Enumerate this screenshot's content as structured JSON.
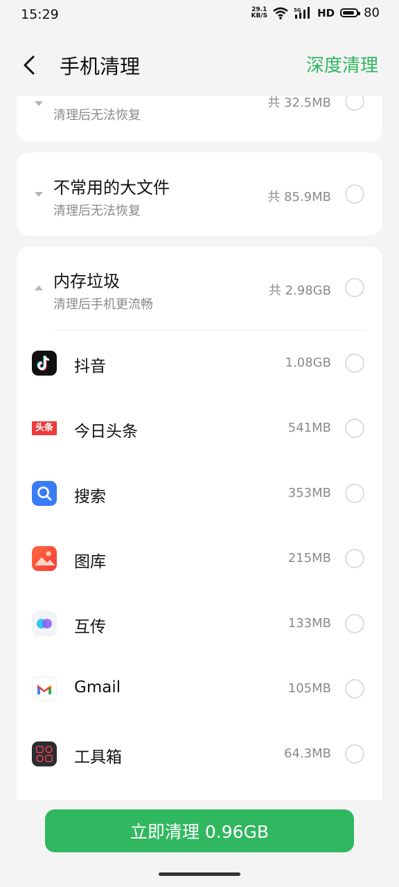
{
  "status_bar": {
    "time": "15:29",
    "net_speed_value": "29.1",
    "net_speed_unit": "KB/S",
    "network": "5G",
    "hd": "HD",
    "battery": "80"
  },
  "header": {
    "title": "手机清理",
    "action": "深度清理"
  },
  "sections": [
    {
      "title": "",
      "subtitle": "清理后无法恢复",
      "total": "共 32.5MB",
      "expanded": false
    },
    {
      "title": "不常用的大文件",
      "subtitle": "清理后无法恢复",
      "total": "共 85.9MB",
      "expanded": false
    },
    {
      "title": "内存垃圾",
      "subtitle": "清理后手机更流畅",
      "total": "共 2.98GB",
      "expanded": true
    }
  ],
  "apps": [
    {
      "name": "抖音",
      "size": "1.08GB",
      "icon": "douyin-icon"
    },
    {
      "name": "今日头条",
      "size": "541MB",
      "icon": "toutiao-icon"
    },
    {
      "name": "搜索",
      "size": "353MB",
      "icon": "search-app-icon"
    },
    {
      "name": "图库",
      "size": "215MB",
      "icon": "gallery-icon"
    },
    {
      "name": "互传",
      "size": "133MB",
      "icon": "transfer-icon"
    },
    {
      "name": "Gmail",
      "size": "105MB",
      "icon": "gmail-icon"
    },
    {
      "name": "工具箱",
      "size": "64.3MB",
      "icon": "toolbox-icon"
    }
  ],
  "toutiao_icon_text": "头条",
  "clean_button": "立即清理 0.96GB",
  "colors": {
    "accent": "#31b760",
    "background": "#f4f4f4"
  }
}
